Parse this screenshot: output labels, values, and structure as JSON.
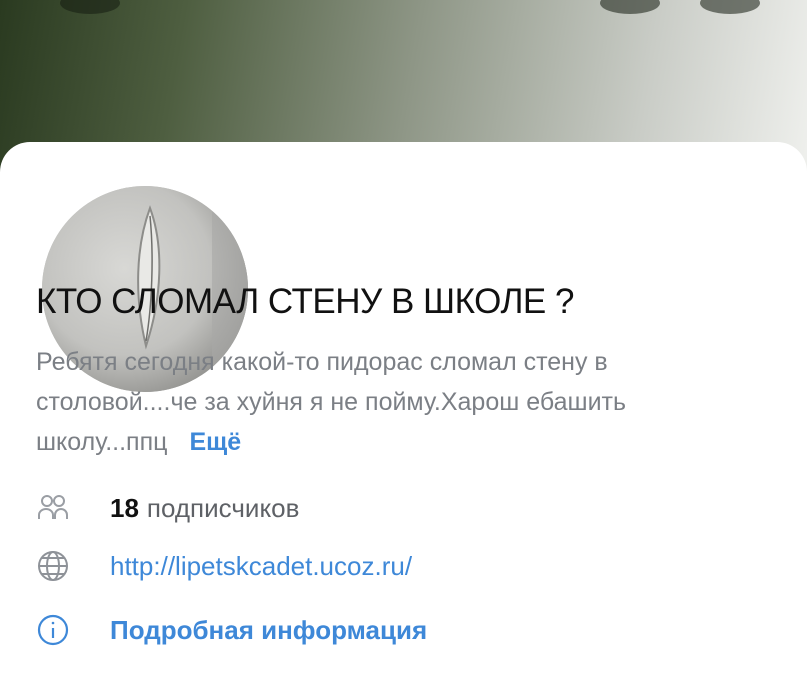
{
  "group": {
    "title": "КТО СЛОМАЛ СТЕНУ В ШКОЛЕ ?",
    "description": "Ребятя сегодня какой-то пидорас сломал стену в столовой....че за хуйня я не пойму.Харош ебашить школу...ппц",
    "more_label": "Ещё"
  },
  "subscribers": {
    "count": "18",
    "label": "подписчиков",
    "icon": "people-icon"
  },
  "website": {
    "url": "http://lipetskcadet.ucoz.ru/",
    "icon": "globe-icon"
  },
  "info": {
    "label": "Подробная информация",
    "icon": "info-icon"
  },
  "colors": {
    "accent": "#3e88d8",
    "secondary_text": "#7b7f85",
    "title": "#111111"
  }
}
